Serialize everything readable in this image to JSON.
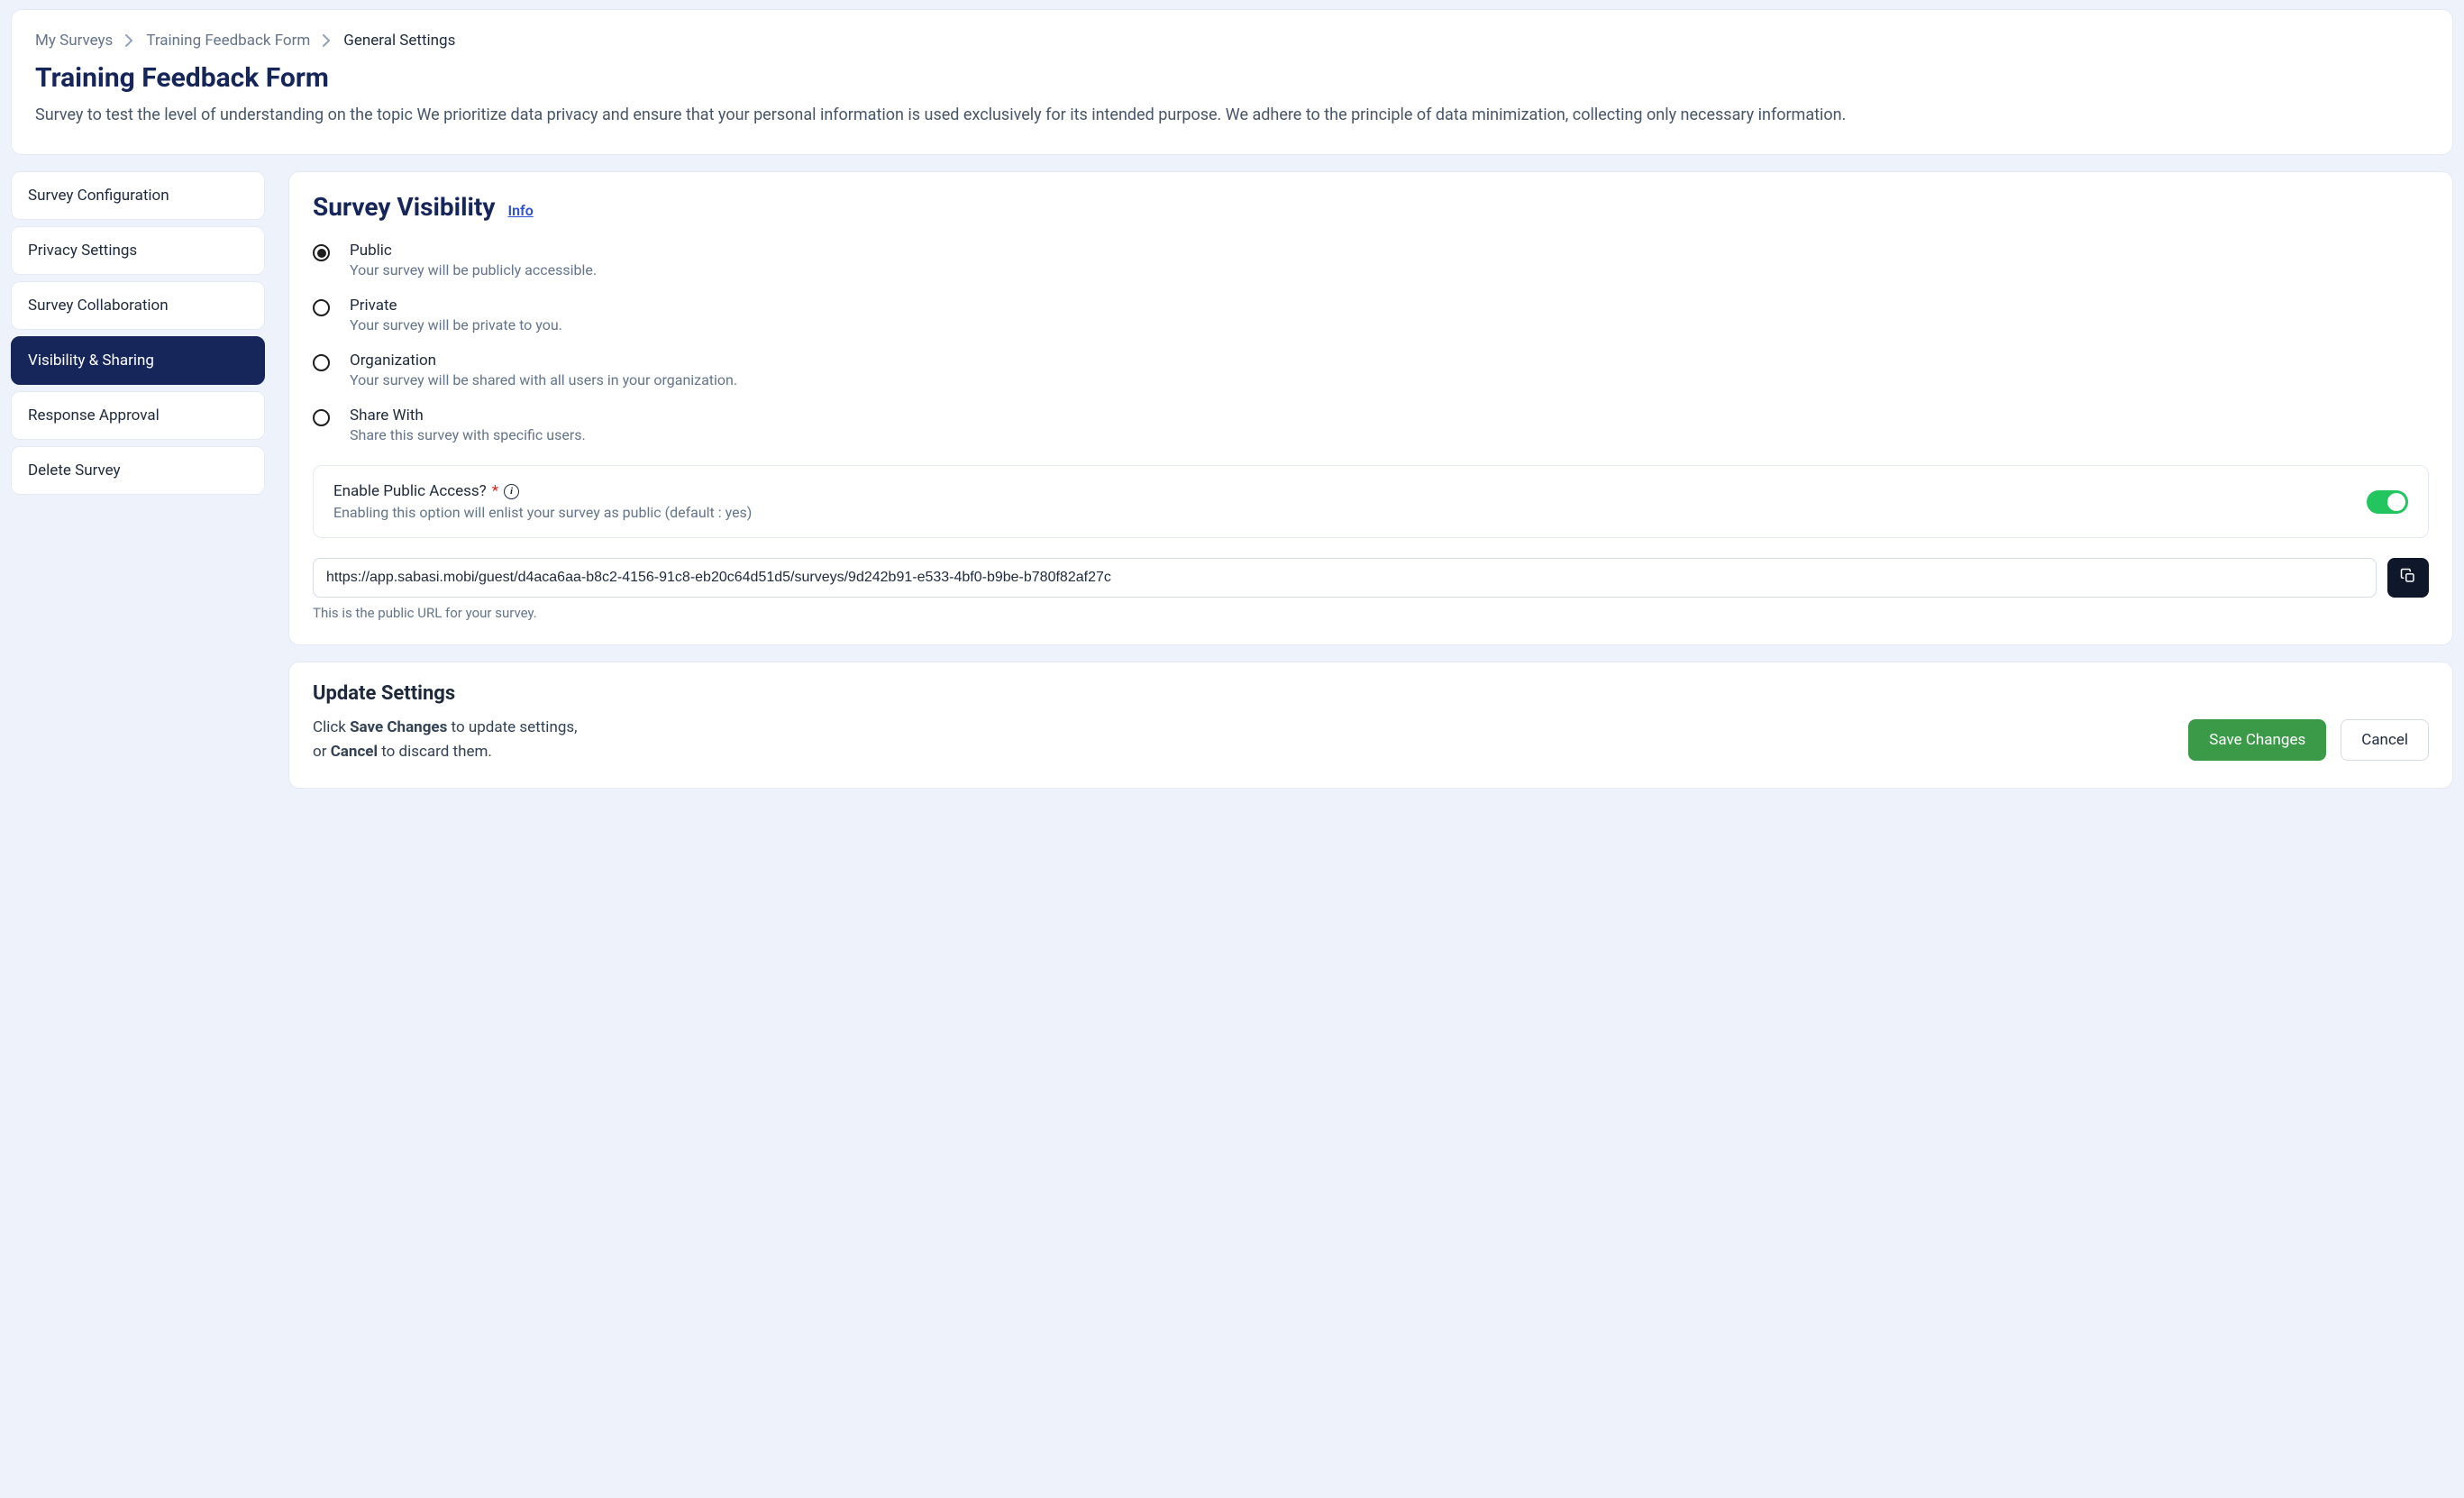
{
  "breadcrumb": {
    "items": [
      "My Surveys",
      "Training Feedback Form",
      "General Settings"
    ]
  },
  "header": {
    "title": "Training Feedback Form",
    "description": "Survey to test the level of understanding on the topic We prioritize data privacy and ensure that your personal information is used exclusively for its intended purpose. We adhere to the principle of data minimization, collecting only necessary information."
  },
  "sidebar": {
    "items": [
      {
        "label": "Survey Configuration",
        "active": false
      },
      {
        "label": "Privacy Settings",
        "active": false
      },
      {
        "label": "Survey Collaboration",
        "active": false
      },
      {
        "label": "Visibility & Sharing",
        "active": true
      },
      {
        "label": "Response Approval",
        "active": false
      },
      {
        "label": "Delete Survey",
        "active": false
      }
    ]
  },
  "visibility": {
    "title": "Survey Visibility",
    "info_label": "Info",
    "options": [
      {
        "label": "Public",
        "desc": "Your survey will be publicly accessible.",
        "selected": true
      },
      {
        "label": "Private",
        "desc": "Your survey will be private to you.",
        "selected": false
      },
      {
        "label": "Organization",
        "desc": "Your survey will be shared with all users in your organization.",
        "selected": false
      },
      {
        "label": "Share With",
        "desc": "Share this survey with specific users.",
        "selected": false
      }
    ],
    "toggle": {
      "label": "Enable Public Access?",
      "required_mark": "*",
      "desc": "Enabling this option will enlist your survey as public (default : yes)",
      "value": true
    },
    "url": "https://app.sabasi.mobi/guest/d4aca6aa-b8c2-4156-91c8-eb20c64d51d5/surveys/9d242b91-e533-4bf0-b9be-b780f82af27c",
    "url_hint": "This is the public URL for your survey."
  },
  "update": {
    "title": "Update Settings",
    "text_prefix": "Click ",
    "text_strong1": "Save Changes",
    "text_mid": " to update settings,",
    "text_line2_prefix": "or ",
    "text_strong2": "Cancel",
    "text_line2_suffix": " to discard them.",
    "save_label": "Save Changes",
    "cancel_label": "Cancel"
  }
}
